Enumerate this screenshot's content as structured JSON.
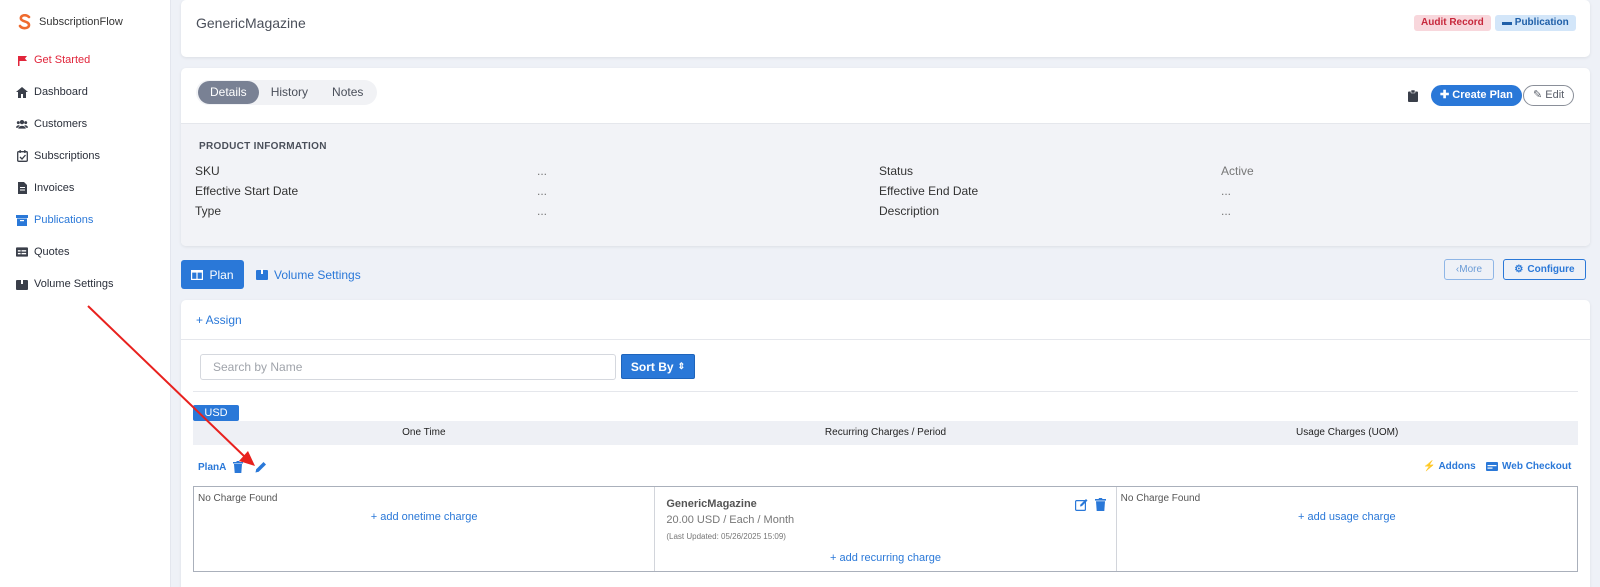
{
  "app": {
    "name": "SubscriptionFlow"
  },
  "sidebar": {
    "items": [
      {
        "label": "Get Started",
        "icon": "flag-icon",
        "state": "red"
      },
      {
        "label": "Dashboard",
        "icon": "home-icon",
        "state": ""
      },
      {
        "label": "Customers",
        "icon": "users-icon",
        "state": ""
      },
      {
        "label": "Subscriptions",
        "icon": "calendar-check-icon",
        "state": ""
      },
      {
        "label": "Invoices",
        "icon": "invoice-icon",
        "state": ""
      },
      {
        "label": "Publications",
        "icon": "archive-icon",
        "state": "active"
      },
      {
        "label": "Quotes",
        "icon": "quotes-icon",
        "state": ""
      },
      {
        "label": "Volume Settings",
        "icon": "box-icon",
        "state": ""
      }
    ]
  },
  "header": {
    "title": "GenericMagazine",
    "badges": {
      "audit": "Audit Record",
      "publication": "Publication"
    }
  },
  "details": {
    "tabs": [
      "Details",
      "History",
      "Notes"
    ],
    "active_tab": "Details",
    "create_plan_label": "Create Plan",
    "edit_label": "Edit",
    "section_title": "PRODUCT INFORMATION",
    "fields": {
      "sku": {
        "label": "SKU",
        "value": "..."
      },
      "effective_start": {
        "label": "Effective Start Date",
        "value": "..."
      },
      "type": {
        "label": "Type",
        "value": "..."
      },
      "status": {
        "label": "Status",
        "value": "Active"
      },
      "effective_end": {
        "label": "Effective End Date",
        "value": "..."
      },
      "description": {
        "label": "Description",
        "value": "..."
      }
    }
  },
  "plan_tabs": {
    "plan_label": "Plan",
    "volume_label": "Volume Settings",
    "more_label": "More",
    "configure_label": "Configure"
  },
  "plans": {
    "assign_label": "+ Assign",
    "search_placeholder": "Search by Name",
    "sort_label": "Sort By",
    "currency": "USD",
    "columns": [
      "One Time",
      "Recurring Charges / Period",
      "Usage Charges (UOM)"
    ],
    "plan_name": "PlanA",
    "addons_label": "Addons",
    "web_checkout_label": "Web Checkout",
    "onetime": {
      "empty": "No Charge Found",
      "add": "+ add onetime charge"
    },
    "recurring": {
      "name": "GenericMagazine",
      "price": "20.00 USD / Each / Month",
      "updated": "(Last Updated: 05/26/2025 15:09)",
      "add": "+ add recurring charge"
    },
    "usage": {
      "empty": "No Charge Found",
      "add": "+ add usage charge"
    }
  },
  "colors": {
    "accent": "#2a78d8",
    "danger": "#e1253b",
    "annotation": "#e8211e"
  }
}
